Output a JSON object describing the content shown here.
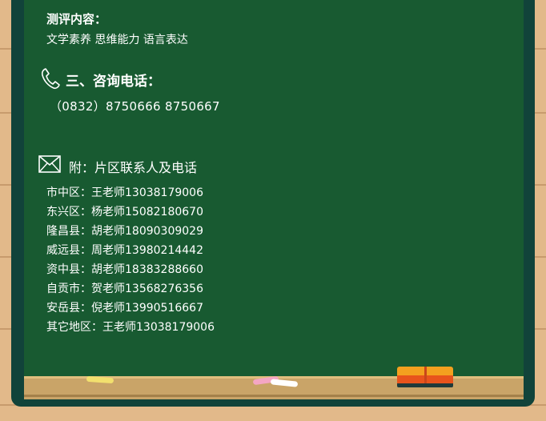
{
  "evaluation": {
    "heading": "测评内容：",
    "content": "文学素养   思维能力  语言表达"
  },
  "consult": {
    "heading": "三、咨询电话：",
    "phones": "（0832）8750666     8750667"
  },
  "appendix": {
    "heading": "附：片区联系人及电话",
    "contacts": [
      "市中区：王老师13038179006",
      "东兴区：杨老师15082180670",
      "隆昌县：胡老师18090309029",
      "威远县：周老师13980214442",
      "资中县：胡老师18383288660",
      "自贡市：贺老师13568276356",
      "安岳县：倪老师13990516667",
      "其它地区：王老师13038179006"
    ]
  },
  "icons": {
    "phone": "phone-handset-icon",
    "mail": "envelope-icon"
  },
  "colors": {
    "board": "#185a31",
    "frame": "#11433a",
    "wood": "#e2b98a",
    "text": "#ffffff"
  }
}
